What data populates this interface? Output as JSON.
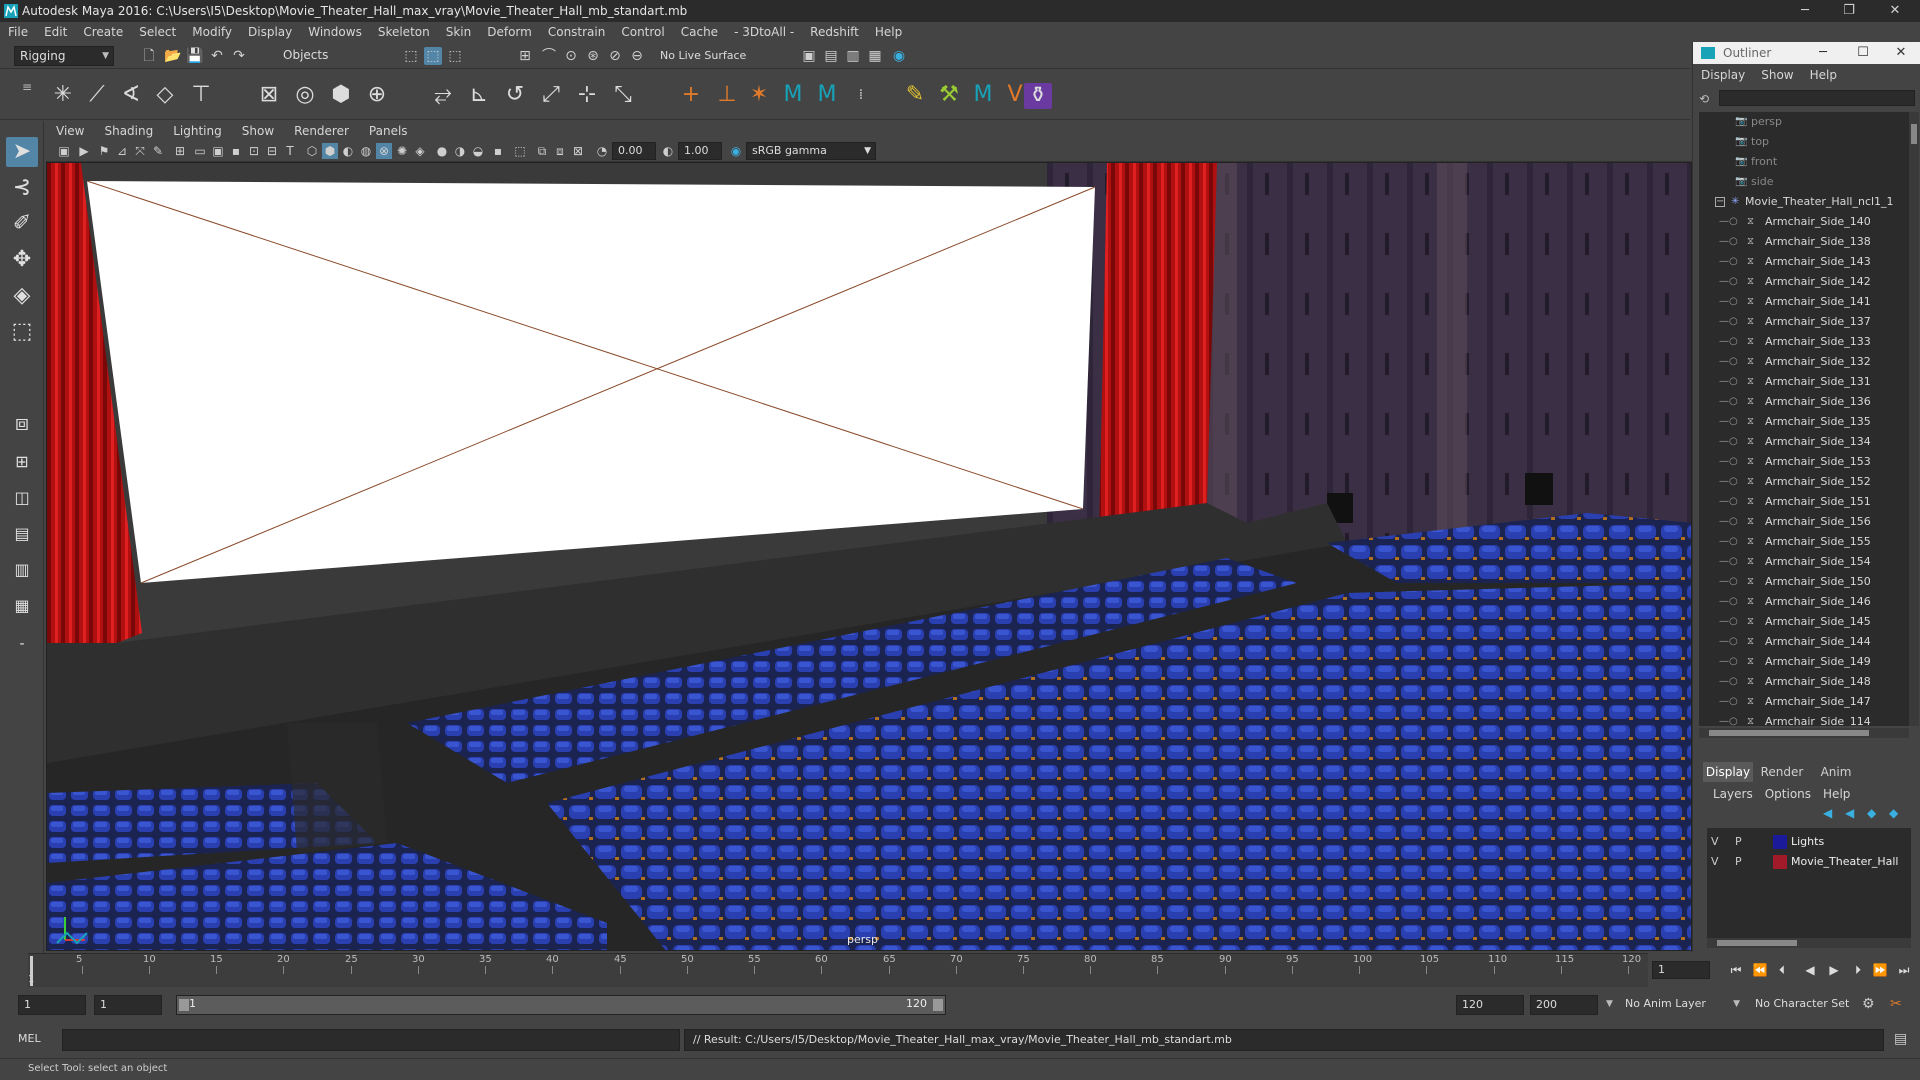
{
  "window": {
    "title": "Autodesk Maya 2016: C:\\Users\\I5\\Desktop\\Movie_Theater_Hall_max_vray\\Movie_Theater_Hall_mb_standart.mb",
    "minimize": "─",
    "maximize": "❐",
    "close": "✕"
  },
  "menubar": [
    "File",
    "Edit",
    "Create",
    "Select",
    "Modify",
    "Display",
    "Windows",
    "Skeleton",
    "Skin",
    "Deform",
    "Constrain",
    "Control",
    "Cache",
    "- 3DtoAll -",
    "Redshift",
    "Help"
  ],
  "statusline": {
    "mode": "Rigging",
    "selection_mode": "Objects",
    "live_surface": "No Live Surface"
  },
  "viewport": {
    "menu": [
      "View",
      "Shading",
      "Lighting",
      "Show",
      "Renderer",
      "Panels"
    ],
    "exposure": "0.00",
    "gamma": "1.00",
    "color_space": "sRGB gamma",
    "camera_label": "persp"
  },
  "outliner": {
    "title": "Outliner",
    "menu": [
      "Display",
      "Show",
      "Help"
    ],
    "cameras": [
      "persp",
      "top",
      "front",
      "side"
    ],
    "group": "Movie_Theater_Hall_ncl1_1",
    "items": [
      "Armchair_Side_140",
      "Armchair_Side_138",
      "Armchair_Side_143",
      "Armchair_Side_142",
      "Armchair_Side_141",
      "Armchair_Side_137",
      "Armchair_Side_133",
      "Armchair_Side_132",
      "Armchair_Side_131",
      "Armchair_Side_136",
      "Armchair_Side_135",
      "Armchair_Side_134",
      "Armchair_Side_153",
      "Armchair_Side_152",
      "Armchair_Side_151",
      "Armchair_Side_156",
      "Armchair_Side_155",
      "Armchair_Side_154",
      "Armchair_Side_150",
      "Armchair_Side_146",
      "Armchair_Side_145",
      "Armchair_Side_144",
      "Armchair_Side_149",
      "Armchair_Side_148",
      "Armchair_Side_147",
      "Armchair_Side_114"
    ]
  },
  "layer_editor": {
    "tabs": [
      "Display",
      "Render",
      "Anim"
    ],
    "menu": [
      "Layers",
      "Options",
      "Help"
    ],
    "layers": [
      {
        "v": "V",
        "p": "P",
        "name": "Lights",
        "color": "#1a1a9a"
      },
      {
        "v": "V",
        "p": "P",
        "name": "Movie_Theater_Hall",
        "color": "#a01a2a"
      }
    ]
  },
  "timeline": {
    "ticks": [
      5,
      10,
      15,
      20,
      25,
      30,
      35,
      40,
      45,
      50,
      55,
      60,
      65,
      70,
      75,
      80,
      85,
      90,
      95,
      100,
      105,
      110,
      115,
      120
    ],
    "start_label": "1",
    "current_frame": "1"
  },
  "range": {
    "start": "1",
    "playback_start": "1",
    "slider_start": "1",
    "slider_end": "120",
    "playback_end": "120",
    "end": "200",
    "anim_layer": "No Anim Layer",
    "character_set": "No Character Set"
  },
  "command": {
    "language": "MEL",
    "result": "// Result: C:/Users/I5/Desktop/Movie_Theater_Hall_max_vray/Movie_Theater_Hall_mb_standart.mb"
  },
  "helpline": "Select Tool: select an object"
}
